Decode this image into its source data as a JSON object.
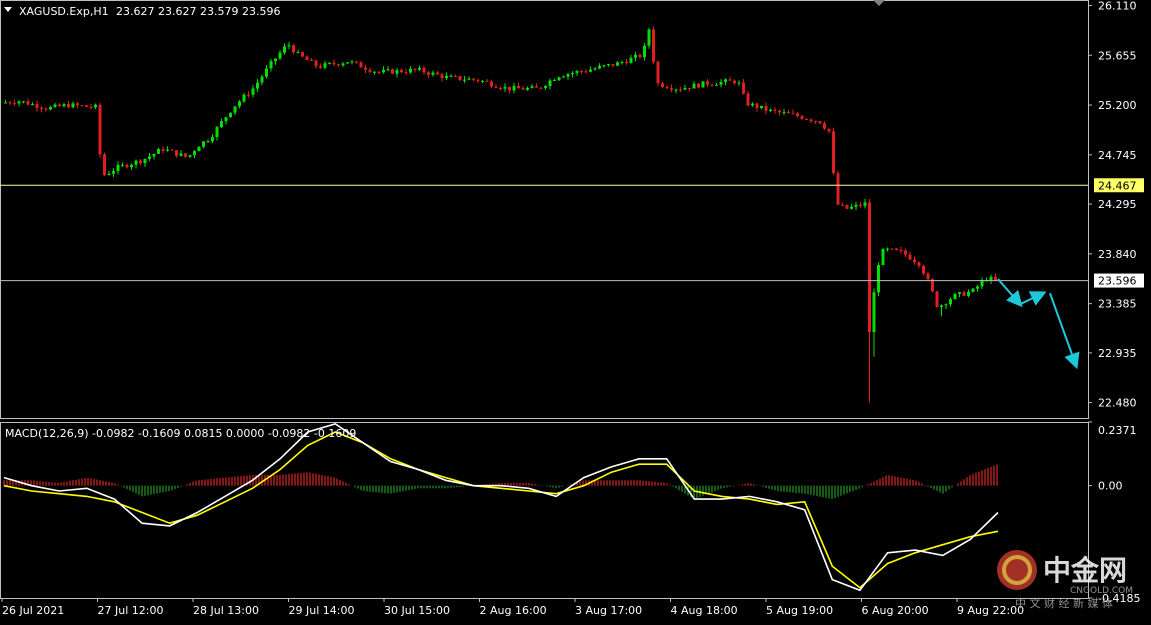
{
  "header": {
    "symbol_label": "XAGUSD.Exp,H1",
    "ohlc_label": "23.627 23.627 23.579 23.596"
  },
  "macd": {
    "label": "MACD(12,26,9) -0.0982 -0.1609 0.0815 0.0000 -0.0982 -0.1609"
  },
  "watermark": {
    "brand": "中金网",
    "sub": "中 文 财 经 新 媒 体",
    "domain": "CNGOLD.COM"
  },
  "colors": {
    "background": "#000000",
    "bull": "#00e000",
    "bear": "#e02020",
    "macd_line": "#ffffff",
    "signal_line": "#ffff00",
    "hist_pos": "#b02020",
    "hist_neg": "#1e7a1e",
    "hline_highlight": "#ffff99",
    "hline_current": "#c0c0c0",
    "arrow": "#1ec8d8",
    "grid_border": "#c0c0c0"
  },
  "chart_data": [
    {
      "type": "candlestick",
      "title": "XAGUSD.Exp,H1",
      "timeframe": "H1",
      "ylim": [
        22.34,
        26.16
      ],
      "yticks": [
        26.11,
        25.655,
        25.2,
        24.745,
        24.295,
        23.84,
        23.385,
        22.935,
        22.48
      ],
      "ytick_labels": [
        "26.110",
        "25.655",
        "25.200",
        "24.745",
        "24.295",
        "23.840",
        "23.385",
        "22.935",
        "22.480"
      ],
      "xtick_labels": [
        "26 Jul 2021",
        "27 Jul 12:00",
        "28 Jul 13:00",
        "29 Jul 14:00",
        "30 Jul 15:00",
        "2 Aug 16:00",
        "3 Aug 17:00",
        "4 Aug 18:00",
        "5 Aug 19:00",
        "6 Aug 20:00",
        "9 Aug 22:00"
      ],
      "hlines": [
        {
          "value": 24.467,
          "label": "24.467",
          "style": "highlight"
        },
        {
          "value": 23.596,
          "label": "23.596",
          "style": "current"
        }
      ],
      "last_price": 23.596,
      "price_path": [
        [
          0,
          25.3
        ],
        [
          4,
          25.22
        ],
        [
          20,
          25.24
        ],
        [
          50,
          25.17
        ],
        [
          70,
          25.2
        ],
        [
          98,
          25.18
        ],
        [
          104,
          24.55
        ],
        [
          120,
          24.63
        ],
        [
          145,
          24.7
        ],
        [
          165,
          24.8
        ],
        [
          190,
          24.72
        ],
        [
          200,
          24.83
        ],
        [
          212,
          24.9
        ],
        [
          235,
          25.18
        ],
        [
          255,
          25.35
        ],
        [
          275,
          25.6
        ],
        [
          290,
          25.76
        ],
        [
          300,
          25.66
        ],
        [
          320,
          25.55
        ],
        [
          350,
          25.6
        ],
        [
          380,
          25.5
        ],
        [
          420,
          25.52
        ],
        [
          450,
          25.45
        ],
        [
          480,
          25.43
        ],
        [
          510,
          25.35
        ],
        [
          540,
          25.35
        ],
        [
          560,
          25.47
        ],
        [
          590,
          25.52
        ],
        [
          620,
          25.58
        ],
        [
          645,
          25.66
        ],
        [
          652,
          25.93
        ],
        [
          658,
          25.4
        ],
        [
          680,
          25.35
        ],
        [
          710,
          25.4
        ],
        [
          740,
          25.42
        ],
        [
          748,
          25.22
        ],
        [
          770,
          25.15
        ],
        [
          800,
          25.1
        ],
        [
          822,
          25.05
        ],
        [
          832,
          24.95
        ],
        [
          838,
          24.3
        ],
        [
          848,
          24.25
        ],
        [
          868,
          24.3
        ],
        [
          872,
          23.0
        ],
        [
          878,
          23.7
        ],
        [
          886,
          23.88
        ],
        [
          905,
          23.85
        ],
        [
          922,
          23.75
        ],
        [
          932,
          23.55
        ],
        [
          940,
          23.35
        ],
        [
          955,
          23.45
        ],
        [
          975,
          23.5
        ],
        [
          988,
          23.62
        ],
        [
          998,
          23.596
        ]
      ],
      "spike_lows": [
        [
          870,
          22.48
        ],
        [
          873,
          22.9
        ],
        [
          942,
          23.27
        ]
      ],
      "forecast_arrows": [
        {
          "from": [
            998,
            23.61
          ],
          "to": [
            1020,
            23.38
          ]
        },
        {
          "from": [
            1020,
            23.38
          ],
          "to": [
            1043,
            23.48
          ]
        },
        {
          "from": [
            1050,
            23.48
          ],
          "to": [
            1076,
            22.82
          ]
        }
      ]
    },
    {
      "type": "line",
      "title": "MACD(12,26,9)",
      "series": [
        {
          "name": "MACD",
          "style": "white",
          "values": [
            0.03,
            0.0,
            -0.02,
            -0.01,
            -0.05,
            -0.14,
            -0.15,
            -0.1,
            -0.04,
            0.02,
            0.1,
            0.2,
            0.23,
            0.16,
            0.09,
            0.06,
            0.02,
            0.0,
            0.0,
            -0.01,
            -0.04,
            0.03,
            0.07,
            0.1,
            0.1,
            -0.05,
            -0.05,
            -0.04,
            -0.06,
            -0.09,
            -0.35,
            -0.39,
            -0.25,
            -0.24,
            -0.26,
            -0.2,
            -0.1
          ]
        },
        {
          "name": "Signal",
          "style": "yellow",
          "values": [
            0.0,
            -0.02,
            -0.03,
            -0.04,
            -0.06,
            -0.1,
            -0.14,
            -0.11,
            -0.06,
            -0.01,
            0.06,
            0.15,
            0.2,
            0.16,
            0.1,
            0.06,
            0.03,
            0.0,
            -0.01,
            -0.02,
            -0.03,
            0.0,
            0.05,
            0.08,
            0.08,
            -0.02,
            -0.04,
            -0.05,
            -0.07,
            -0.06,
            -0.3,
            -0.38,
            -0.29,
            -0.25,
            -0.22,
            -0.19,
            -0.17
          ]
        },
        {
          "name": "Histogram",
          "style": "bars",
          "values": [
            0.02,
            0.02,
            0.01,
            0.03,
            0.01,
            -0.04,
            -0.02,
            0.02,
            0.03,
            0.04,
            0.04,
            0.05,
            0.03,
            -0.02,
            -0.03,
            -0.01,
            -0.01,
            0.0,
            0.01,
            0.01,
            -0.01,
            0.02,
            0.02,
            0.02,
            0.01,
            -0.05,
            -0.01,
            0.01,
            -0.02,
            -0.03,
            -0.05,
            -0.01,
            0.04,
            0.02,
            -0.03,
            0.04,
            0.08
          ]
        }
      ],
      "ylim": [
        -0.4185,
        0.2371
      ],
      "ytick_labels": [
        "0.2371",
        "0.00",
        "-0.4185"
      ]
    }
  ]
}
